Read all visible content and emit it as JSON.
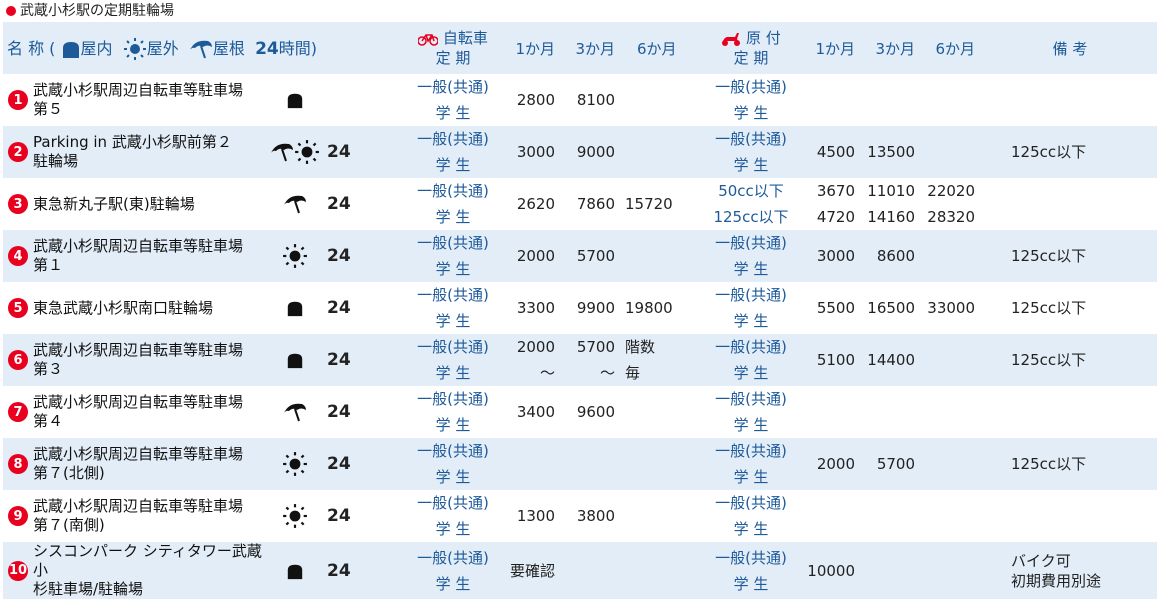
{
  "title": "武蔵小杉駅の定期駐輪場",
  "header": {
    "name_label": "名 称 (",
    "indoor": "屋内",
    "outdoor": "屋外",
    "roofed": "屋根",
    "h24": "24",
    "h24_label": "時間)",
    "bicycle_label": "自転車",
    "bicycle_sub": "定 期",
    "moped_label": "原 付",
    "moped_sub": "定 期",
    "m1": "1か月",
    "m3": "3か月",
    "m6": "6か月",
    "remarks": "備 考"
  },
  "colors": {
    "accent": "#1d5a9a",
    "badge": "#e8001e",
    "row_alt": "#e3edf7"
  },
  "rows": [
    {
      "no": "1",
      "name": [
        "武蔵小杉駅周辺自転車等駐車場",
        "第５"
      ],
      "icons": [
        "indoor-icon"
      ],
      "h24": "",
      "bike_cats": [
        "一般(共通)",
        "学 生"
      ],
      "bike": [
        [
          "2800",
          "8100",
          ""
        ],
        [
          "",
          "",
          ""
        ]
      ],
      "moto_cats": [
        "一般(共通)",
        "学 生"
      ],
      "moto": [
        [
          "",
          "",
          ""
        ],
        [
          "",
          "",
          ""
        ]
      ],
      "note": ""
    },
    {
      "no": "2",
      "name": [
        "Parking in 武蔵小杉駅前第２",
        "駐輪場"
      ],
      "icons": [
        "roof-icon",
        "sun-icon"
      ],
      "h24": "24",
      "bike_cats": [
        "一般(共通)",
        "学 生"
      ],
      "bike": [
        [
          "3000",
          "9000",
          ""
        ],
        [
          "",
          "",
          ""
        ]
      ],
      "moto_cats": [
        "一般(共通)",
        "学 生"
      ],
      "moto": [
        [
          "4500",
          "13500",
          ""
        ],
        [
          "",
          "",
          ""
        ]
      ],
      "note": "125cc以下"
    },
    {
      "no": "3",
      "name": [
        "東急新丸子駅(東)駐輪場"
      ],
      "icons": [
        "roof-icon"
      ],
      "h24": "24",
      "bike_cats": [
        "一般(共通)",
        "学 生"
      ],
      "bike": [
        [
          "2620",
          "7860",
          "15720"
        ],
        [
          "",
          "",
          ""
        ]
      ],
      "moto_cats": [
        "50cc以下",
        "125cc以下"
      ],
      "moto": [
        [
          "3670",
          "11010",
          "22020"
        ],
        [
          "4720",
          "14160",
          "28320"
        ]
      ],
      "note": ""
    },
    {
      "no": "4",
      "name": [
        "武蔵小杉駅周辺自転車等駐車場",
        "第１"
      ],
      "icons": [
        "sun-icon"
      ],
      "h24": "24",
      "bike_cats": [
        "一般(共通)",
        "学 生"
      ],
      "bike": [
        [
          "2000",
          "5700",
          ""
        ],
        [
          "",
          "",
          ""
        ]
      ],
      "moto_cats": [
        "一般(共通)",
        "学 生"
      ],
      "moto": [
        [
          "3000",
          "8600",
          ""
        ],
        [
          "",
          "",
          ""
        ]
      ],
      "note": "125cc以下"
    },
    {
      "no": "5",
      "name": [
        "東急武蔵小杉駅南口駐輪場"
      ],
      "icons": [
        "indoor-icon"
      ],
      "h24": "24",
      "bike_cats": [
        "一般(共通)",
        "学 生"
      ],
      "bike": [
        [
          "3300",
          "9900",
          "19800"
        ],
        [
          "",
          "",
          ""
        ]
      ],
      "moto_cats": [
        "一般(共通)",
        "学 生"
      ],
      "moto": [
        [
          "5500",
          "16500",
          "33000"
        ],
        [
          "",
          "",
          ""
        ]
      ],
      "note": "125cc以下"
    },
    {
      "no": "6",
      "name": [
        "武蔵小杉駅周辺自転車等駐車場",
        "第３"
      ],
      "icons": [
        "indoor-icon"
      ],
      "h24": "24",
      "bike_cats": [
        "一般(共通)",
        "学 生"
      ],
      "bike": [
        [
          "2000～",
          "5700～",
          "階数"
        ],
        [
          "",
          "",
          "毎"
        ]
      ],
      "moto_cats": [
        "一般(共通)",
        "学 生"
      ],
      "moto": [
        [
          "5100",
          "14400",
          ""
        ],
        [
          "",
          "",
          ""
        ]
      ],
      "note": "125cc以下"
    },
    {
      "no": "7",
      "name": [
        "武蔵小杉駅周辺自転車等駐車場",
        "第４"
      ],
      "icons": [
        "roof-icon"
      ],
      "h24": "24",
      "bike_cats": [
        "一般(共通)",
        "学 生"
      ],
      "bike": [
        [
          "3400",
          "9600",
          ""
        ],
        [
          "",
          "",
          ""
        ]
      ],
      "moto_cats": [
        "一般(共通)",
        "学 生"
      ],
      "moto": [
        [
          "",
          "",
          ""
        ],
        [
          "",
          "",
          ""
        ]
      ],
      "note": ""
    },
    {
      "no": "8",
      "name": [
        "武蔵小杉駅周辺自転車等駐車場",
        "第７(北側)"
      ],
      "icons": [
        "sun-icon"
      ],
      "h24": "24",
      "bike_cats": [
        "一般(共通)",
        "学 生"
      ],
      "bike": [
        [
          "",
          "",
          ""
        ],
        [
          "",
          "",
          ""
        ]
      ],
      "moto_cats": [
        "一般(共通)",
        "学 生"
      ],
      "moto": [
        [
          "2000",
          "5700",
          ""
        ],
        [
          "",
          "",
          ""
        ]
      ],
      "note": "125cc以下"
    },
    {
      "no": "9",
      "name": [
        "武蔵小杉駅周辺自転車等駐車場",
        "第７(南側)"
      ],
      "icons": [
        "sun-icon"
      ],
      "h24": "24",
      "bike_cats": [
        "一般(共通)",
        "学 生"
      ],
      "bike": [
        [
          "1300",
          "3800",
          ""
        ],
        [
          "",
          "",
          ""
        ]
      ],
      "moto_cats": [
        "一般(共通)",
        "学 生"
      ],
      "moto": [
        [
          "",
          "",
          ""
        ],
        [
          "",
          "",
          ""
        ]
      ],
      "note": ""
    },
    {
      "no": "10",
      "name": [
        "シスコンパーク シティタワー武蔵小",
        "杉駐車場/駐輪場"
      ],
      "icons": [
        "indoor-icon"
      ],
      "h24": "24",
      "bike_cats": [
        "一般(共通)",
        "学 生"
      ],
      "bike": [
        [
          "要確認",
          "",
          ""
        ],
        [
          "",
          "",
          ""
        ]
      ],
      "moto_cats": [
        "一般(共通)",
        "学 生"
      ],
      "moto": [
        [
          "10000",
          "",
          ""
        ],
        [
          "",
          "",
          ""
        ]
      ],
      "note": "バイク可\n初期費用別途"
    }
  ]
}
